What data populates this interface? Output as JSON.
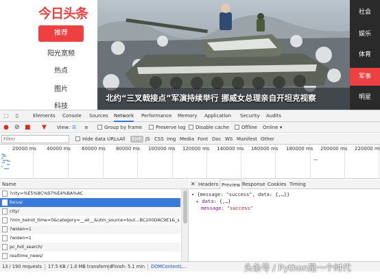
{
  "site": {
    "logo": "今日头条",
    "nav_items": [
      "推荐",
      "阳光宽频",
      "热点",
      "图片",
      "科技"
    ],
    "hero_caption": "北约“三叉戟接点”军演持续举行 挪威女总理亲自开坦克视察",
    "channels": [
      "社会",
      "娱乐",
      "体育",
      "军事",
      "明星"
    ],
    "accent_color": "#ed4040"
  },
  "devtools": {
    "tabs": [
      "Elements",
      "Console",
      "Sources",
      "Network",
      "Performance",
      "Memory",
      "Application",
      "Security",
      "Audits"
    ],
    "selected_tab": "Network",
    "toolbar": {
      "view_label": "View:",
      "group_by_frame": "Group by frame",
      "preserve_log": "Preserve log",
      "disable_cache": "Disable cache",
      "offline": "Offline",
      "throttle_value": "Online"
    },
    "filter": {
      "placeholder": "Filter",
      "hide_data_urls": "Hide data URLs",
      "types": [
        "All",
        "XHR",
        "JS",
        "CSS",
        "Img",
        "Media",
        "Font",
        "Doc",
        "WS",
        "Manifest",
        "Other"
      ],
      "selected_type": "XHR"
    },
    "timeline_ticks": [
      "20000 ms",
      "40000 ms",
      "60000 ms",
      "80000 ms",
      "100000 ms",
      "120000 ms",
      "140000 ms",
      "160000 ms",
      "180000 ms",
      "200000 ms",
      "220000 ms"
    ],
    "requests": {
      "column_name": "Name",
      "rows": [
        "?city=%E5%8C%97%E4%BA%AC",
        "focus/",
        "city/",
        "?min_behot_time=0&category=__all__&utm_source=tout...BC200DAC9E1&_s",
        "?widen=1",
        "?widen=1",
        "pc_hot_search/",
        "realtime_news/"
      ],
      "selected_index": 1
    },
    "detail_tabs": [
      "Headers",
      "Preview",
      "Response",
      "Cookies",
      "Timing"
    ],
    "selected_detail_tab": "Preview",
    "preview": {
      "line1": "{message: \"success\", data: {,…}}",
      "data_key": "data",
      "data_value": "{,…}",
      "message_key": "message",
      "message_value": "\"success\""
    },
    "status": {
      "requests": "13 / 190 requests",
      "transferred": "17.5 KB / 1.0 MB transferred",
      "finish": "Finish: 5.1 min",
      "dom": "DOMContentL..."
    }
  },
  "watermark": "头条号 / Python是一个时代"
}
